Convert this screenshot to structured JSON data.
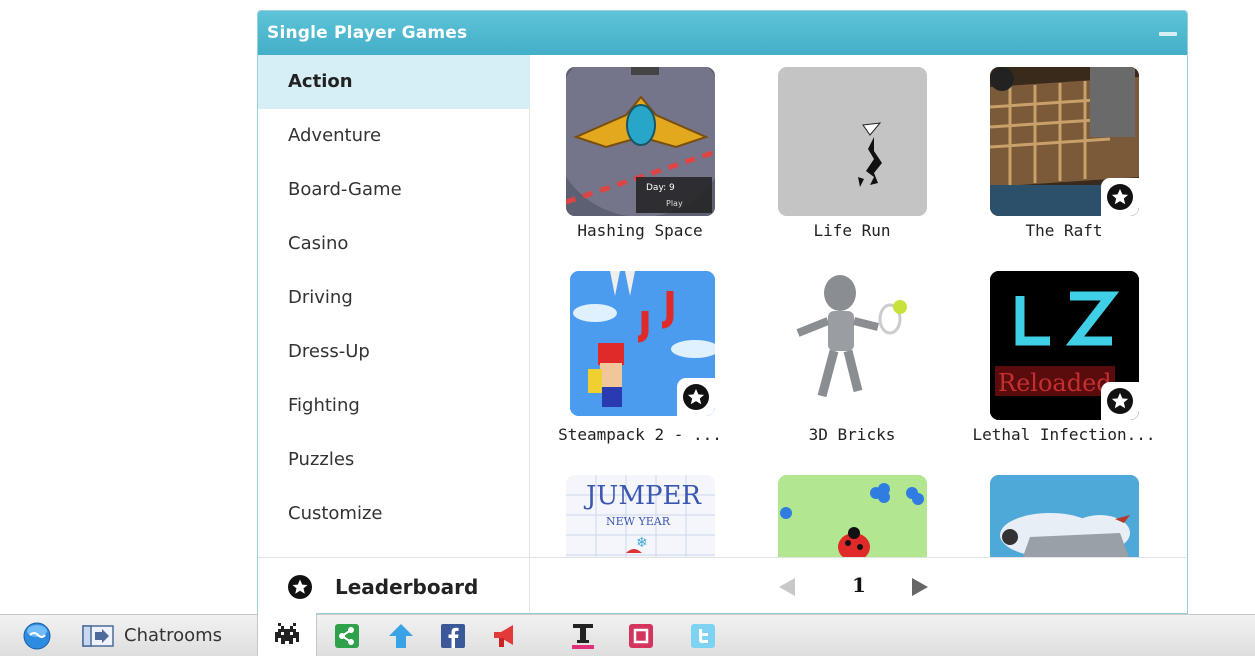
{
  "panel": {
    "title": "Single Player Games"
  },
  "categories": [
    {
      "label": "Action",
      "active": true
    },
    {
      "label": "Adventure",
      "active": false
    },
    {
      "label": "Board-Game",
      "active": false
    },
    {
      "label": "Casino",
      "active": false
    },
    {
      "label": "Driving",
      "active": false
    },
    {
      "label": "Dress-Up",
      "active": false
    },
    {
      "label": "Fighting",
      "active": false
    },
    {
      "label": "Puzzles",
      "active": false
    },
    {
      "label": "Customize",
      "active": false
    }
  ],
  "leaderboard": {
    "label": "Leaderboard",
    "icon": "star-icon"
  },
  "games": [
    {
      "name": "Hashing Space",
      "badge": false,
      "thumb_text_1": "Day: 9",
      "thumb_text_2": "Play"
    },
    {
      "name": "Life Run",
      "badge": false
    },
    {
      "name": "The Raft",
      "badge": true
    },
    {
      "name": "Steampack 2 - ...",
      "badge": true
    },
    {
      "name": "3D Bricks",
      "badge": false
    },
    {
      "name": "Lethal Infection...",
      "badge": true
    },
    {
      "name": "",
      "badge": false,
      "thumb_text_1": "JUMPER",
      "thumb_text_2": "NEW YEAR"
    },
    {
      "name": "",
      "badge": false
    },
    {
      "name": "",
      "badge": false
    }
  ],
  "pagination": {
    "current_page": "1"
  },
  "bottombar": {
    "chatrooms_label": "Chatrooms",
    "icons": [
      "globe-icon",
      "chatrooms-icon",
      "games-icon",
      "share-icon",
      "upload-icon",
      "facebook-icon",
      "announce-icon",
      "text-style-icon",
      "window-icon",
      "twitter-icon"
    ]
  },
  "colors": {
    "header": "#4bb7ce",
    "active_category_bg": "#d6eff6",
    "accent": "#4bb7ce"
  }
}
